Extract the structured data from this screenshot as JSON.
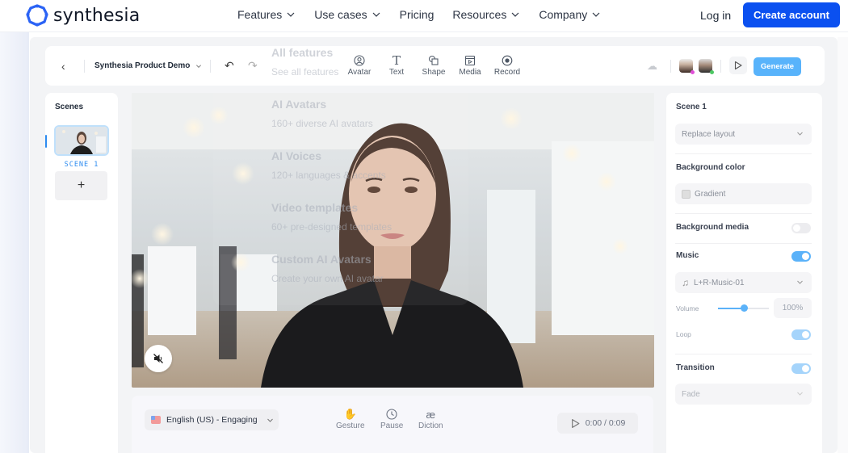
{
  "site": {
    "brand": "synthesia",
    "brand_color": "#0b50f0",
    "nav": [
      {
        "label": "Features",
        "has_dropdown": true
      },
      {
        "label": "Use cases",
        "has_dropdown": true
      },
      {
        "label": "Pricing",
        "has_dropdown": false
      },
      {
        "label": "Resources",
        "has_dropdown": true
      },
      {
        "label": "Company",
        "has_dropdown": true
      }
    ],
    "login": "Log in",
    "create_account": "Create account"
  },
  "features_menu": {
    "items": [
      {
        "title": "All features",
        "subtitle": "See all features",
        "icon": "cube-icon"
      },
      {
        "title": "AI Avatars",
        "subtitle": "160+ diverse AI avatars",
        "icon": "user-icon"
      },
      {
        "title": "AI Voices",
        "subtitle": "120+ languages & accents",
        "icon": "microphone-icon"
      },
      {
        "title": "Video templates",
        "subtitle": "60+ pre-designed templates",
        "icon": "template-icon"
      },
      {
        "title": "Custom AI Avatars",
        "subtitle": "Create your own AI avatar",
        "icon": "custom-avatar-icon"
      }
    ]
  },
  "editor": {
    "toolbar": {
      "project_title": "Synthesia Product Demo",
      "tools": [
        {
          "label": "Avatar",
          "icon": "avatar-icon"
        },
        {
          "label": "Text",
          "icon": "text-icon"
        },
        {
          "label": "Shape",
          "icon": "shape-icon"
        },
        {
          "label": "Media",
          "icon": "media-icon"
        },
        {
          "label": "Record",
          "icon": "record-icon"
        }
      ],
      "generate": "Generate",
      "generate_color": "#58b3fb"
    },
    "scenes": {
      "title": "Scenes",
      "items": [
        {
          "label": "SCENE 1",
          "selected": true
        }
      ],
      "add": "+"
    },
    "bottom_bar": {
      "language": "English (US) - Engaging",
      "tools": [
        {
          "label": "Gesture",
          "icon": "hand-wave-icon"
        },
        {
          "label": "Pause",
          "icon": "clock-icon"
        },
        {
          "label": "Diction",
          "icon": "ae-ligature-icon"
        }
      ],
      "time": "0:00 / 0:09"
    },
    "properties": {
      "scene_title": "Scene 1",
      "layout_select": "Replace layout",
      "background_color_label": "Background color",
      "background_color_value": "Gradient",
      "background_media_label": "Background media",
      "background_media_on": false,
      "music_label": "Music",
      "music_on": true,
      "music_track": "L+R-Music-01",
      "volume_label": "Volume",
      "volume_value": "100%",
      "volume_fraction": 0.5,
      "loop_label": "Loop",
      "loop_on": true,
      "transition_label": "Transition",
      "transition_on": true,
      "transition_value": "Fade"
    }
  }
}
